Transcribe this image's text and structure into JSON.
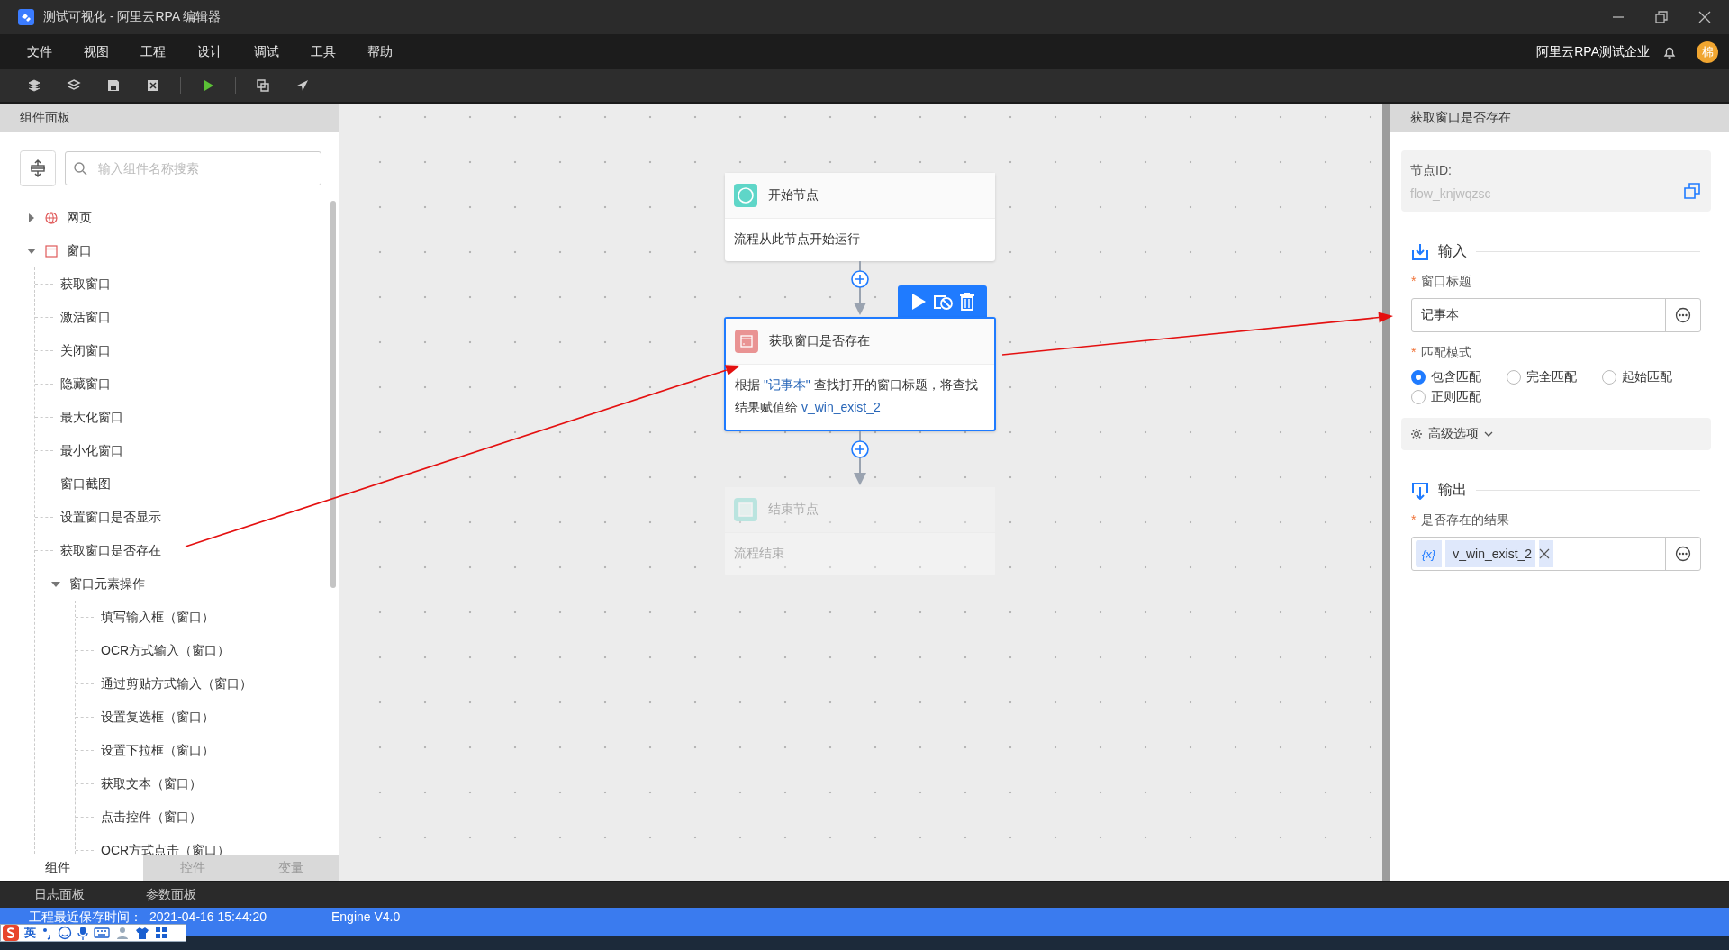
{
  "window": {
    "title": "测试可视化 - 阿里云RPA 编辑器"
  },
  "menu": [
    "文件",
    "视图",
    "工程",
    "设计",
    "调试",
    "工具",
    "帮助"
  ],
  "account": {
    "company": "阿里云RPA测试企业",
    "avatar": "棉"
  },
  "left_panel": {
    "title": "组件面板",
    "search": {
      "placeholder": "输入组件名称搜索"
    },
    "tree": [
      {
        "label": "网页",
        "kind": "web",
        "expanded": false
      },
      {
        "label": "窗口",
        "kind": "window",
        "expanded": true,
        "children": [
          {
            "label": "获取窗口"
          },
          {
            "label": "激活窗口"
          },
          {
            "label": "关闭窗口"
          },
          {
            "label": "隐藏窗口"
          },
          {
            "label": "最大化窗口"
          },
          {
            "label": "最小化窗口"
          },
          {
            "label": "窗口截图"
          },
          {
            "label": "设置窗口是否显示"
          },
          {
            "label": "获取窗口是否存在"
          },
          {
            "label": "窗口元素操作",
            "expanded": true,
            "children": [
              {
                "label": "填写输入框（窗口）"
              },
              {
                "label": "OCR方式输入（窗口）"
              },
              {
                "label": "通过剪贴方式输入（窗口）"
              },
              {
                "label": "设置复选框（窗口）"
              },
              {
                "label": "设置下拉框（窗口）"
              },
              {
                "label": "获取文本（窗口）"
              },
              {
                "label": "点击控件（窗口）"
              },
              {
                "label": "OCR方式点击（窗口）"
              }
            ]
          }
        ]
      }
    ],
    "tabs": [
      {
        "label": "组件",
        "selected": true
      },
      {
        "label": "控件",
        "selected": false
      },
      {
        "label": "变量",
        "selected": false
      }
    ]
  },
  "canvas": {
    "nodes": [
      {
        "kind": "start",
        "title": "开始节点",
        "selected": false,
        "faded": false,
        "description": [
          {
            "text": "流程从此节点开始运行",
            "highlight": false
          }
        ]
      },
      {
        "kind": "window",
        "title": "获取窗口是否存在",
        "selected": true,
        "faded": false,
        "description": [
          {
            "text": "根据 ",
            "highlight": false
          },
          {
            "text": "\"记事本\"",
            "highlight": true
          },
          {
            "text": " 查找打开的窗口标题，将查找结果赋值给 ",
            "highlight": false
          },
          {
            "text": "v_win_exist_2",
            "highlight": true
          }
        ]
      },
      {
        "kind": "end",
        "title": "结束节点",
        "selected": false,
        "faded": true,
        "description": [
          {
            "text": "流程结束",
            "highlight": false
          }
        ]
      }
    ]
  },
  "properties": {
    "title": "获取窗口是否存在",
    "node_id": {
      "label": "节点ID:",
      "value": "flow_knjwqzsc"
    },
    "input": {
      "title": "输入",
      "fields": [
        {
          "kind": "text",
          "label": "窗口标题",
          "required_mark": "*",
          "value": "记事本"
        },
        {
          "kind": "radio",
          "label": "匹配模式",
          "required_mark": "*",
          "options": [
            {
              "label": "包含匹配",
              "selected": true
            },
            {
              "label": "完全匹配",
              "selected": false
            },
            {
              "label": "起始匹配",
              "selected": false
            },
            {
              "label": "正则匹配",
              "selected": false
            }
          ]
        }
      ]
    },
    "advanced": {
      "label": "高级选项"
    },
    "output": {
      "title": "输出",
      "fields": [
        {
          "kind": "variable",
          "label": "是否存在的结果",
          "required_mark": "*",
          "tag_icon": "{x}",
          "value": "v_win_exist_2"
        }
      ]
    }
  },
  "bottom_tabs": [
    "日志面板",
    "参数面板"
  ],
  "status_bar": {
    "label": "工程最近保存时间：",
    "time": "2021-04-16 15:44:20",
    "engine": "Engine V4.0"
  },
  "ime": {
    "label": "英"
  }
}
